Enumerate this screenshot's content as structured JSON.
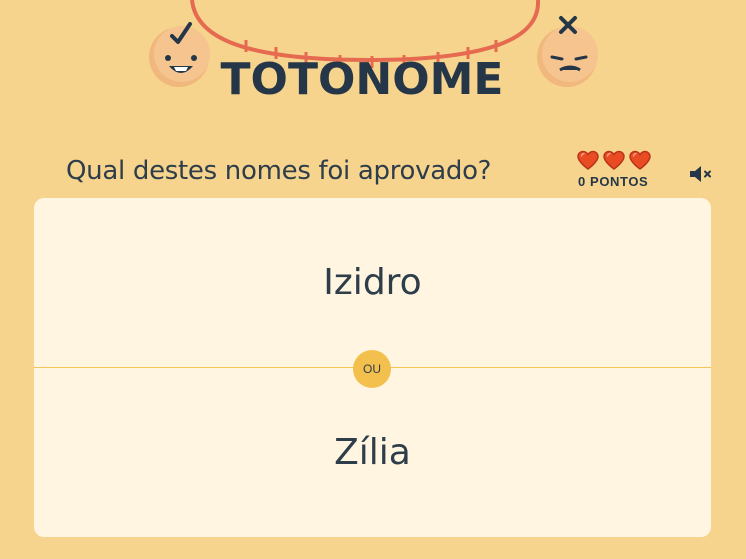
{
  "logo": {
    "title": "TOTONOME"
  },
  "game": {
    "question": "Qual destes nomes foi aprovado?",
    "lives": 3,
    "points_label": "0 PONTOS",
    "sound": "muted-speaker-icon"
  },
  "options": {
    "first": "Izidro",
    "separator": "OU",
    "second": "Zília"
  },
  "colors": {
    "background": "#f6d48d",
    "card": "#fff5e0",
    "text": "#2e3d4a",
    "heart": "#e94b23",
    "accent": "#f3c04e"
  }
}
